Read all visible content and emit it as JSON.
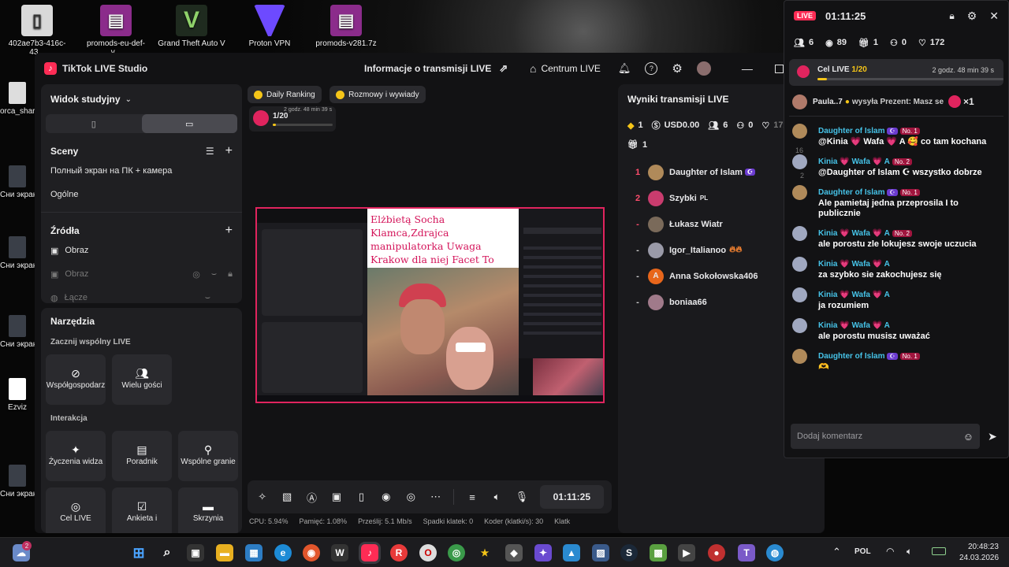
{
  "desktop": {
    "icons": [
      {
        "label": "402ae7b3-416c-43...",
        "icon": "file-icon",
        "color": "#d9d9d9"
      },
      {
        "label": "promods-eu-def-v...",
        "icon": "winrar-icon",
        "color": "#8b2c8b"
      },
      {
        "label": "Grand Theft Auto V",
        "icon": "gta-icon",
        "color": "#1f6b2e"
      },
      {
        "label": "Proton VPN",
        "icon": "protonvpn-icon",
        "color": "#6d4aff"
      },
      {
        "label": "promods-v281.7z",
        "icon": "winrar-icon",
        "color": "#8b2c8b"
      }
    ],
    "side_labels": [
      "orca_shar",
      "Сни экрана_2",
      "Сни экрана_2",
      "Сни экрана_2",
      "Ezviz",
      "Сни экрана_1"
    ]
  },
  "studio": {
    "app_title": "TikTok LIVE Studio",
    "stream_info": "Informacje o transmisji LIVE",
    "live_center": "Centrum LIVE",
    "view_mode": "Widok studyjny",
    "scenes_title": "Sceny",
    "scenes": [
      "Полный экран на ПК + камера",
      "Ogólne"
    ],
    "sources_title": "Źródła",
    "sources": [
      "Obraz",
      "Obraz",
      "Łącze"
    ],
    "tools_title": "Narzędzia",
    "collab_title": "Zacznij wspólny LIVE",
    "collab_tools": [
      "Współgospodarz",
      "Wielu gości"
    ],
    "interaction_title": "Interakcja",
    "interaction_tools": [
      "Życzenia widza",
      "Poradnik",
      "Wspólne granie",
      "Cel LIVE",
      "Ankieta i",
      "Skrzynia"
    ],
    "chips": [
      "Daily Ranking",
      "Rozmowy i wywiady"
    ],
    "goal": {
      "count": "1/20",
      "time": "2 godz. 48 min 39 s",
      "progress": 0.05
    },
    "preview_caption": "Elżbietą Socha Klamca,Zdrajca manipulatorka Uwaga Krakow dla niej Facet To Zabawka",
    "timer": "01:11:25",
    "stats": [
      "CPU: 5.94%",
      "Pamięć: 1.08%",
      "Prześlij: 5.1 Mb/s",
      "Spadki klatek: 0",
      "Koder (klatki/s): 30",
      "Klatk"
    ]
  },
  "results": {
    "title": "Wyniki transmisji LIVE",
    "diamonds": "1",
    "usd": "USD0.00",
    "viewers": "6",
    "new_followers": "0",
    "likes": "172",
    "gifts": "1",
    "ranking": [
      {
        "rank": "1",
        "name": "Daughter of Islam",
        "avatar": "#b08a5a"
      },
      {
        "rank": "2",
        "name": "Szybki",
        "flag": "PL",
        "avatar": "#c93c6e"
      },
      {
        "rank": "-",
        "name": "Łukasz Wiatr",
        "avatar": "#7a6a5a"
      },
      {
        "rank": "-",
        "name": "Igor_Italianoo",
        "avatar": "#9a9aa8"
      },
      {
        "rank": "-",
        "name": "Anna Sokołowska406",
        "avatar": "#e8661b",
        "initial": "A"
      },
      {
        "rank": "-",
        "name": "boniaa66",
        "avatar": "#a07a8a"
      }
    ]
  },
  "chat": {
    "live_label": "LIVE",
    "time": "01:11:25",
    "counts": {
      "viewers_now": "6",
      "views": "89",
      "gifts": "1",
      "new": "0",
      "likes": "172"
    },
    "goal": {
      "label": "Cel LIVE",
      "count": "1/20",
      "time": "2 godz. 48 min 39 s",
      "progress": 0.05
    },
    "gift_banner": {
      "user": "Paula..7",
      "text": "wysyła Prezent: Masz se",
      "count": "×1"
    },
    "messages": [
      {
        "user": "Daughter of Islam",
        "level": "No. 1",
        "text": "@Kinia 💗 Wafa 💗 A 🥰 co tam kochana",
        "avatar": "#b08a5a"
      },
      {
        "user": "Kinia 💗 Wafa 💗 A",
        "level": "No. 2",
        "text": "@Daughter of Islam ☪ wszystko dobrze",
        "avatar": "#a0a8c0"
      },
      {
        "user": "Daughter of Islam",
        "level": "No. 1",
        "text": "Ale pamietaj jedna przeprosila I to publicznie",
        "avatar": "#b08a5a"
      },
      {
        "user": "Kinia 💗 Wafa 💗 A",
        "level": "No. 2",
        "text": "ale porostu zle lokujesz swoje uczucia",
        "avatar": "#a0a8c0"
      },
      {
        "user": "Kinia 💗 Wafa 💗 A",
        "level": "",
        "text": "za szybko sie zakochujesz się",
        "avatar": "#a0a8c0"
      },
      {
        "user": "Kinia 💗 Wafa 💗 A",
        "level": "",
        "text": "ja rozumiem",
        "avatar": "#a0a8c0"
      },
      {
        "user": "Kinia 💗 Wafa 💗 A",
        "level": "",
        "text": "ale porostu musisz uważać",
        "avatar": "#a0a8c0"
      },
      {
        "user": "Daughter of Islam",
        "level": "No. 1",
        "text": "🫶",
        "avatar": "#b08a5a"
      }
    ],
    "side_numbers": [
      "16",
      "2"
    ],
    "input_placeholder": "Dodaj komentarz"
  },
  "taskbar": {
    "weather_badge": "2",
    "lang": "POL",
    "time": "20:48:23",
    "date": "24.03.2026"
  },
  "colors": {
    "accent": "#fe2c55",
    "username": "#46c3e8",
    "progress": "#f5c518"
  }
}
